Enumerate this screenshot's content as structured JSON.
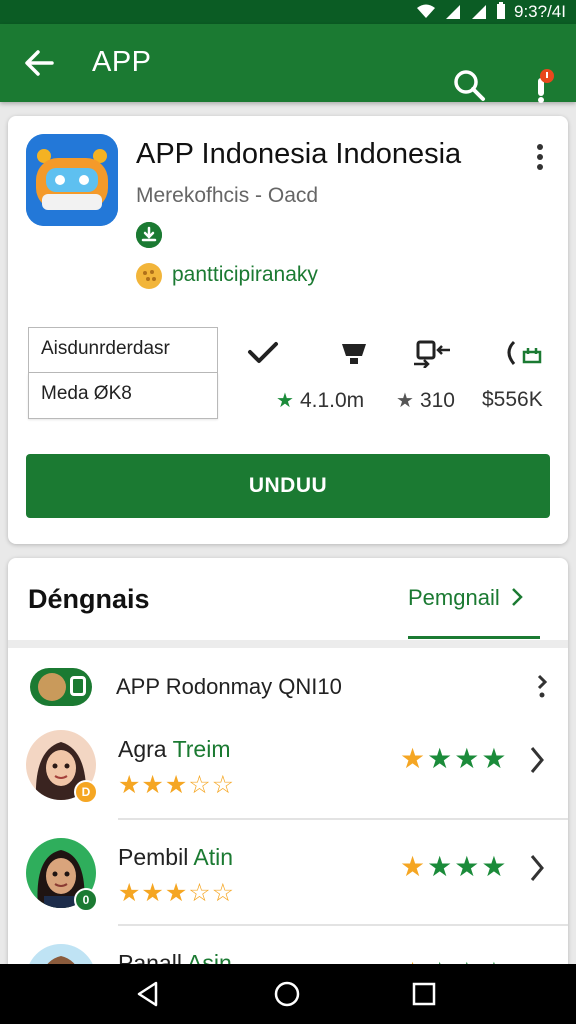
{
  "status_bar": {
    "time": "9:3?/4I",
    "icons": [
      "wifi-icon",
      "signal-icon",
      "signal-icon",
      "battery-icon"
    ]
  },
  "app_bar": {
    "title": "APP",
    "icons": [
      "back-arrow-icon",
      "search-icon",
      "notification-icon"
    ],
    "colors": {
      "primary": "#1b7a32",
      "status": "#0b5c24"
    }
  },
  "app_card": {
    "app_name": "APP Indonesia Indonesia",
    "developer": "Merekofhcis - Oacd",
    "promo_text": "pantticipiranaky",
    "fields": {
      "first_value": "Aisdunrderdasr",
      "second_value": "Meda ØK8"
    },
    "stats": [
      {
        "icon": "star-icon",
        "value": "4.1.0m"
      },
      {
        "icon": "star-icon",
        "value": "310"
      },
      {
        "icon": "share-icon",
        "value": "$556K"
      }
    ],
    "install_label": "UNDUU"
  },
  "reviews": {
    "section_title": "Déngnais",
    "see_all_label": "Pemgnail",
    "top_row_label": "APP Rodonmay QNI10",
    "items": [
      {
        "name_part1": "Agra",
        "name_part2": " Treim",
        "rating_small": "★★★☆☆",
        "rating_big": "★★★★",
        "badge": "D"
      },
      {
        "name_part1": "Pembil",
        "name_part2": " Atin",
        "rating_small": "★★★☆☆",
        "rating_big": "★★★★",
        "badge": "0"
      },
      {
        "name_part1": "Panall",
        "name_part2": " Asin",
        "rating_small": "★★★☆☆",
        "rating_big": "★★★★",
        "badge": ""
      }
    ]
  },
  "nav_bar": {
    "icons": [
      "back-triangle-icon",
      "home-circle-icon",
      "recents-square-icon"
    ]
  }
}
